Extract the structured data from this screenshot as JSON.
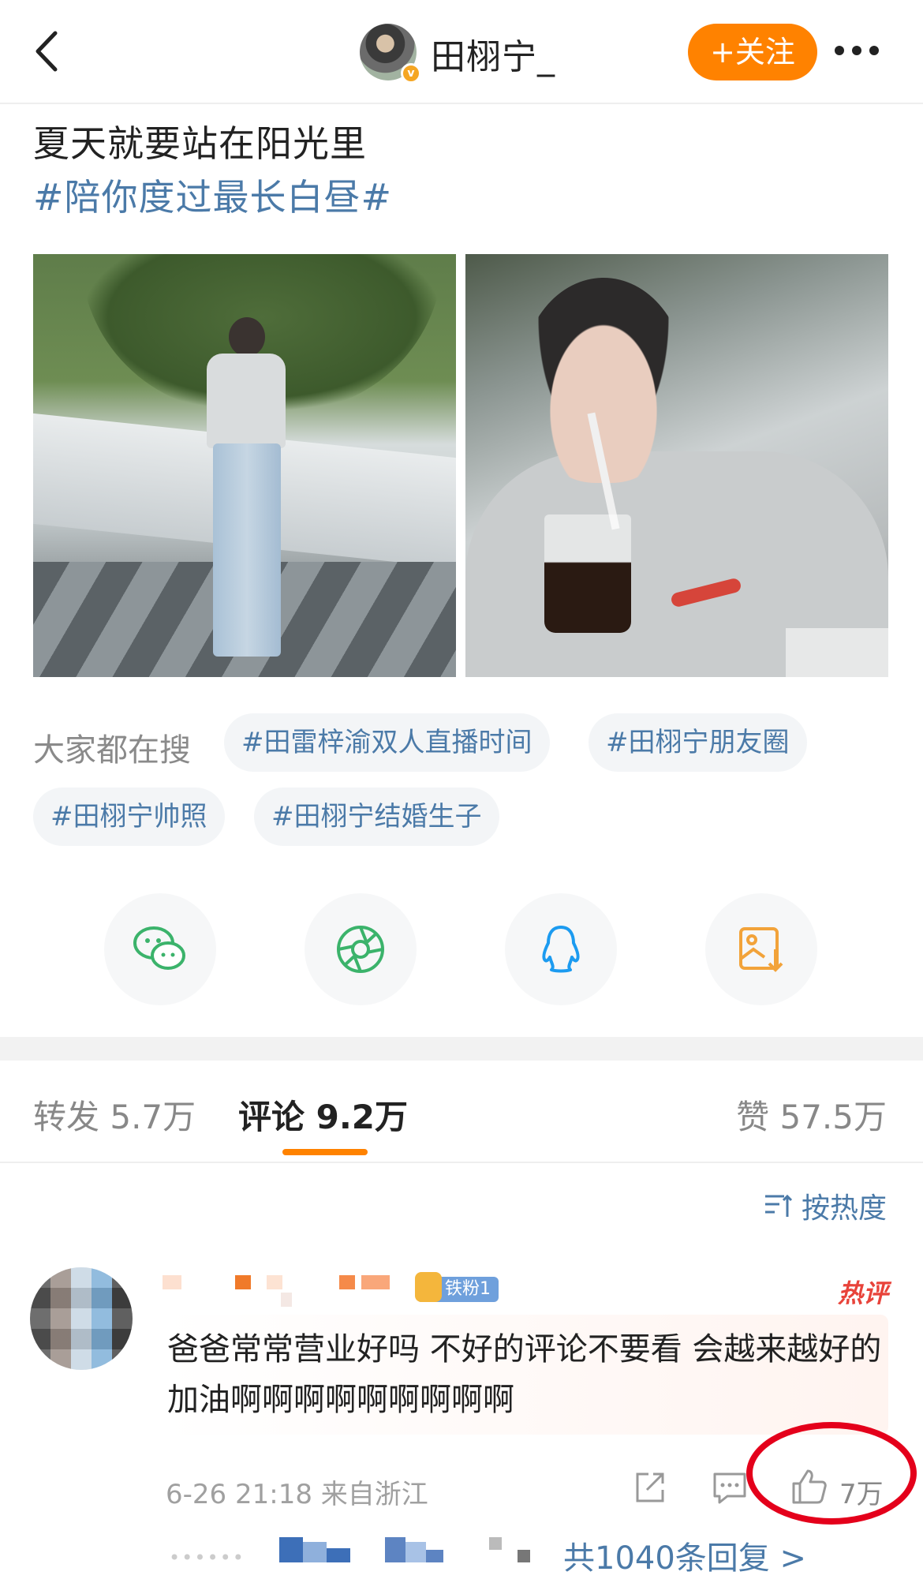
{
  "header": {
    "user_name": "田栩宁_",
    "follow_label": "+关注"
  },
  "post": {
    "text": "夏天就要站在阳光里",
    "hashtag": "#陪你度过最长白昼#"
  },
  "trending": {
    "label": "大家都在搜",
    "tags": [
      "#田雷梓渝双人直播时间",
      "#田栩宁朋友圈",
      "#田栩宁帅照",
      "#田栩宁结婚生子"
    ]
  },
  "share": {
    "icons": [
      "wechat-icon",
      "moments-icon",
      "qq-icon",
      "save-image-icon"
    ]
  },
  "tabs": {
    "repost": "转发 5.7万",
    "comments": "评论 9.2万",
    "likes": "赞 57.5万"
  },
  "sort": {
    "label": "按热度"
  },
  "comment": {
    "fan_badge": "铁粉1",
    "hot_badge": "热评",
    "text": "爸爸常常营业好吗 不好的评论不要看 会越来越好的加油啊啊啊啊啊啊啊啊啊",
    "time": "6-26 21:18 来自浙江",
    "like_count": "7万",
    "replies_link": "共1040条回复 >"
  },
  "colors": {
    "accent": "#ff8200",
    "link": "#4b7aa8",
    "highlight": "#e4001b"
  }
}
